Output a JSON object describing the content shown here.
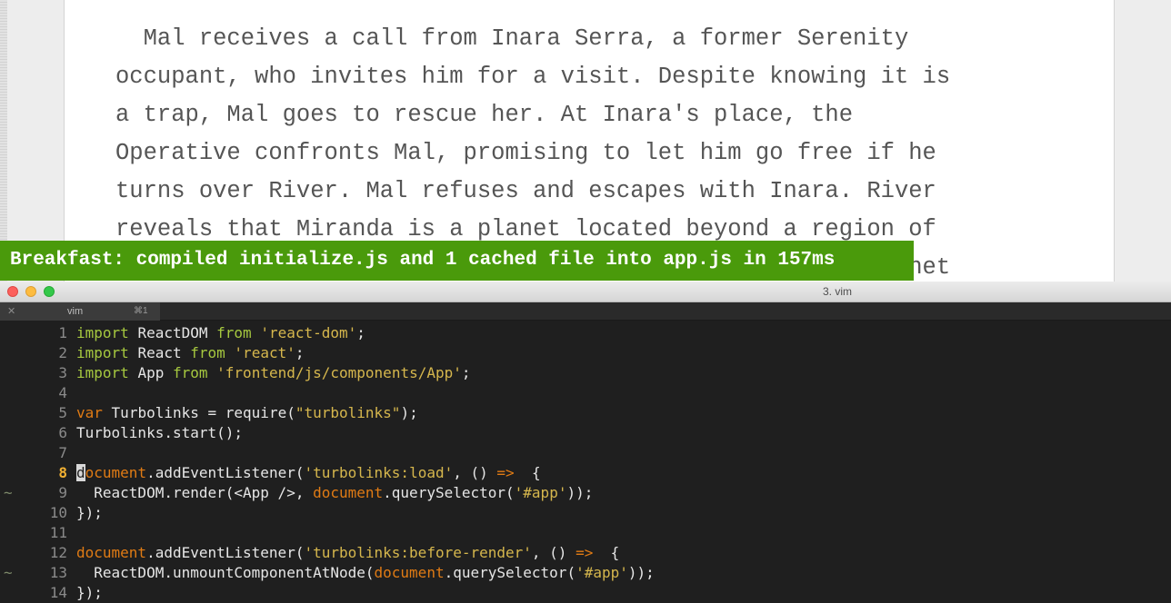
{
  "page": {
    "paragraph_lines": [
      "  Mal receives a call from Inara Serra, a former Serenity",
      "occupant, who invites him for a visit. Despite knowing it is",
      "a trap, Mal goes to rescue her. At Inara's place, the",
      "Operative confronts Mal, promising to let him go free if he",
      "turns over River. Mal refuses and escapes with Inara. River",
      "reveals that Miranda is a planet located beyond a region of",
      "                                                      planet"
    ]
  },
  "banner": {
    "text": "Breakfast: compiled initialize.js and 1 cached file into app.js in 157ms",
    "color": "#4a9a0b"
  },
  "terminal": {
    "window_title": "3. vim",
    "tab": {
      "close": "✕",
      "label": "vim",
      "shortcut": "⌘1"
    },
    "current_line": 8,
    "lines": [
      {
        "n": "1",
        "sign": "",
        "segs": [
          [
            "imp",
            "import"
          ],
          [
            "",
            "ReactDOM"
          ],
          [
            "imp",
            "from"
          ],
          [
            "str",
            "'react-dom'"
          ],
          [
            "",
            ";"
          ]
        ]
      },
      {
        "n": "2",
        "sign": "",
        "segs": [
          [
            "imp",
            "import"
          ],
          [
            "",
            "React"
          ],
          [
            "imp",
            "from"
          ],
          [
            "str",
            "'react'"
          ],
          [
            "",
            ";"
          ]
        ]
      },
      {
        "n": "3",
        "sign": "",
        "segs": [
          [
            "imp",
            "import"
          ],
          [
            "",
            "App"
          ],
          [
            "imp",
            "from"
          ],
          [
            "str",
            "'frontend/js/components/App'"
          ],
          [
            "",
            ";"
          ]
        ]
      },
      {
        "n": "4",
        "sign": "",
        "segs": []
      },
      {
        "n": "5",
        "sign": "",
        "segs": [
          [
            "kw",
            "var"
          ],
          [
            "",
            "Turbolinks = require("
          ],
          [
            "str",
            "\"turbolinks\""
          ],
          [
            "",
            ");"
          ]
        ]
      },
      {
        "n": "6",
        "sign": "",
        "segs": [
          [
            "",
            "Turbolinks.start();"
          ]
        ]
      },
      {
        "n": "7",
        "sign": "",
        "segs": []
      },
      {
        "n": "8",
        "sign": "",
        "segs": [
          [
            "cursor",
            "d"
          ],
          [
            "kw",
            "ocument"
          ],
          [
            "",
            ".addEventListener("
          ],
          [
            "str",
            "'turbolinks:load'"
          ],
          [
            "",
            ", () "
          ],
          [
            "kw",
            "=>"
          ],
          [
            "",
            " {"
          ]
        ]
      },
      {
        "n": "9",
        "sign": "~",
        "segs": [
          [
            "",
            "  ReactDOM.render(<App />, "
          ],
          [
            "kw",
            "document"
          ],
          [
            "",
            ".querySelector("
          ],
          [
            "str",
            "'#app'"
          ],
          [
            "",
            "));"
          ]
        ]
      },
      {
        "n": "10",
        "sign": "",
        "segs": [
          [
            "",
            "});"
          ]
        ]
      },
      {
        "n": "11",
        "sign": "",
        "segs": []
      },
      {
        "n": "12",
        "sign": "",
        "segs": [
          [
            "kw",
            "document"
          ],
          [
            "",
            ".addEventListener("
          ],
          [
            "str",
            "'turbolinks:before-render'"
          ],
          [
            "",
            ", () "
          ],
          [
            "kw",
            "=>"
          ],
          [
            "",
            " {"
          ]
        ]
      },
      {
        "n": "13",
        "sign": "~",
        "segs": [
          [
            "",
            "  ReactDOM.unmountComponentAtNode("
          ],
          [
            "kw",
            "document"
          ],
          [
            "",
            ".querySelector("
          ],
          [
            "str",
            "'#app'"
          ],
          [
            "",
            "));"
          ]
        ]
      },
      {
        "n": "14",
        "sign": "",
        "segs": [
          [
            "",
            "});"
          ]
        ]
      }
    ]
  }
}
